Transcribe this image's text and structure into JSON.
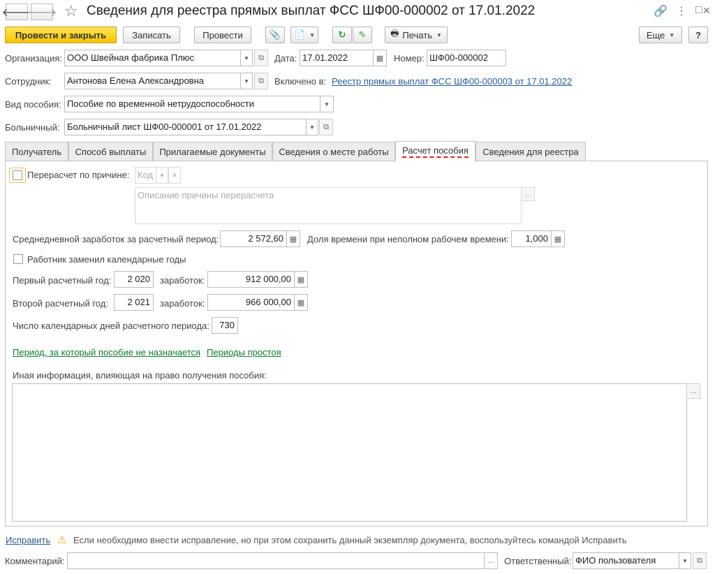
{
  "window": {
    "title": "Сведения для реестра прямых выплат ФСС ШФ00-000002 от 17.01.2022",
    "back_glyph": "🡐",
    "forward_glyph": "🡒",
    "star_glyph": "☆",
    "link_glyph": "🔗",
    "menu_glyph": "⋮",
    "minimize_glyph": "□",
    "close_glyph": "✕"
  },
  "toolbar": {
    "post_and_close": "Провести и закрыть",
    "save": "Записать",
    "post": "Провести",
    "attach_glyph": "📎",
    "create_glyph": "📄",
    "refresh_glyph": "↻",
    "edit_glyph": "✎",
    "print": "Печать",
    "print_glyph": "🖶",
    "more": "Еще",
    "help": "?",
    "caret": "▼"
  },
  "header": {
    "org_label": "Организация:",
    "org_value": "ООО Швейная фабрика Плюс",
    "date_label": "Дата:",
    "date_value": "17.01.2022",
    "number_label": "Номер:",
    "number_value": "ШФ00-000002",
    "employee_label": "Сотрудник:",
    "employee_value": "Антонова Елена Александровна",
    "included_label": "Включено в:",
    "included_link": "Реестр прямых выплат ФСС ШФ00-000003 от 17.01.2022",
    "benefit_type_label": "Вид пособия:",
    "benefit_type_value": "Пособие по временной нетрудоспособности",
    "sick_leave_label": "Больничный:",
    "sick_leave_value": "Больничный лист ШФ00-000001 от 17.01.2022"
  },
  "tabs": [
    {
      "label": "Получатель"
    },
    {
      "label": "Способ выплаты"
    },
    {
      "label": "Прилагаемые документы"
    },
    {
      "label": "Сведения о месте работы"
    },
    {
      "label": "Расчет пособия"
    },
    {
      "label": "Сведения для реестра"
    }
  ],
  "calc": {
    "recalc_label": "Перерасчет по причине:",
    "recalc_checked": false,
    "code_placeholder": "Код",
    "clear_glyph": "×",
    "reason_placeholder": "Описание причины перерасчета",
    "ellipsis": "...",
    "avg_earnings_label": "Среднедневной заработок за расчетный период:",
    "avg_earnings_value": "2 572,60",
    "time_share_label": "Доля времени при неполном рабочем времени:",
    "time_share_value": "1,000",
    "replaced_years_label": "Работник заменил календарные годы",
    "replaced_years_checked": false,
    "first_year_label": "Первый расчетный год:",
    "first_year_value": "2 020",
    "earnings_label": "заработок:",
    "first_year_earnings": "912 000,00",
    "second_year_label": "Второй расчетный год:",
    "second_year_value": "2 021",
    "second_year_earnings": "966 000,00",
    "calendar_days_label": "Число календарных дней расчетного периода:",
    "calendar_days_value": "730",
    "link_no_benefit": "Период, за который пособие не назначается",
    "link_downtime": "Периоды простоя",
    "other_info_label": "Иная информация, влияющая на право получения пособия:",
    "calc_glyph": "▦"
  },
  "footer": {
    "fix_link": "Исправить",
    "warning_glyph": "⚠",
    "warning_text": "Если необходимо внести исправление, но при этом сохранить данный экземпляр документа, воспользуйтесь командой Исправить",
    "comment_label": "Комментарий:",
    "comment_value": "",
    "responsible_label": "Ответственный:",
    "responsible_value": "ФИО пользователя",
    "open_glyph": "⧉"
  }
}
